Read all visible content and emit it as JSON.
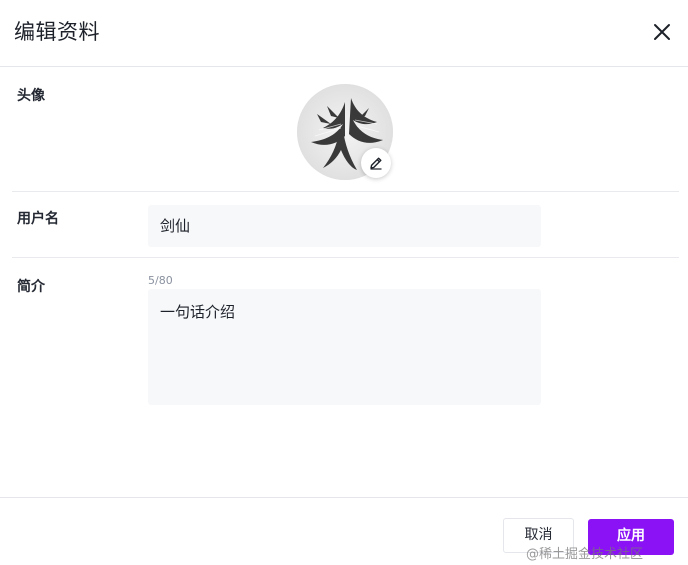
{
  "dialog": {
    "title": "编辑资料"
  },
  "avatar_row": {
    "label": "头像"
  },
  "username_row": {
    "label": "用户名",
    "value": "剑仙"
  },
  "intro_row": {
    "label": "简介",
    "counter": "5/80",
    "value": "一句话介绍"
  },
  "footer": {
    "cancel_label": "取消",
    "apply_label": "应用"
  },
  "watermark": "@稀土掘金技术社区",
  "colors": {
    "accent": "#8a12f5",
    "input_bg": "#f7f8fa",
    "divider": "#e4e6eb"
  },
  "icons": {
    "close": "close-icon",
    "edit": "pencil-icon"
  }
}
